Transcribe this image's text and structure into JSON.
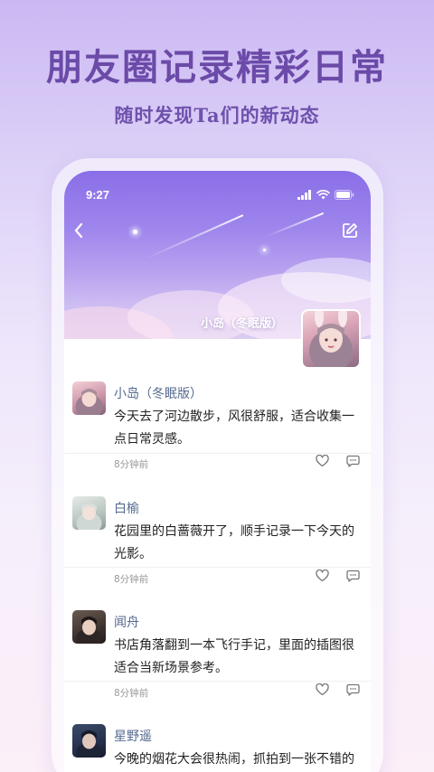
{
  "promo": {
    "title": "朋友圈记录精彩日常",
    "subtitle": "随时发现Ta们的新动态"
  },
  "status_bar": {
    "time": "9:27"
  },
  "profile": {
    "name": "小岛（冬眠版）"
  },
  "posts": [
    {
      "author": "小岛（冬眠版）",
      "text": "今天去了河边散步，风很舒服，适合收集一点日常灵感。",
      "time": "8分钟前"
    },
    {
      "author": "白榆",
      "text": "花园里的白蔷薇开了，顺手记录一下今天的光影。",
      "time": "8分钟前"
    },
    {
      "author": "闻舟",
      "text": "书店角落翻到一本飞行手记，里面的插图很适合当新场景参考。",
      "time": "8分钟前"
    },
    {
      "author": "星野遥",
      "text": "今晚的烟花大会很热闹，抓拍到一张不错的夜景。",
      "time": ""
    }
  ],
  "icons": {
    "back": "chevron-left-icon",
    "edit": "edit-icon",
    "like": "heart-icon",
    "comment": "comment-icon",
    "signal": "signal-icon",
    "wifi": "wifi-icon",
    "battery": "battery-icon"
  },
  "colors": {
    "promo_title": "#6b4aa8",
    "author_name": "#556a8f",
    "cover_top": "#8a6ee8"
  }
}
